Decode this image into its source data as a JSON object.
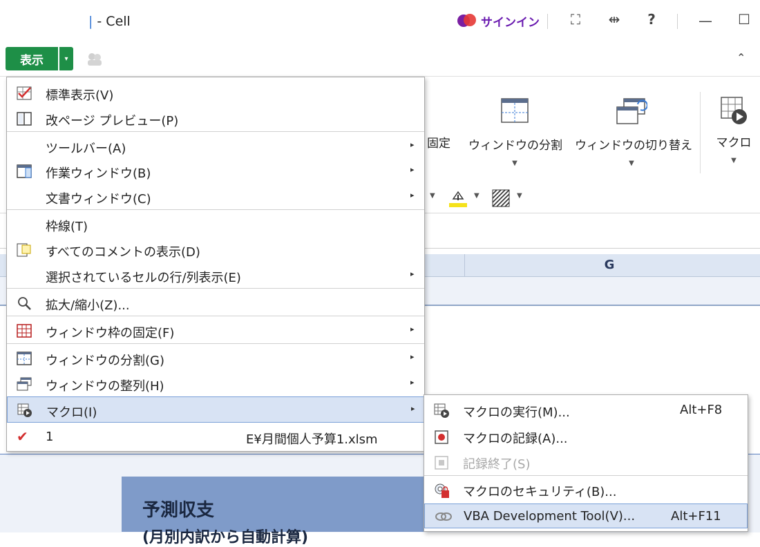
{
  "window": {
    "title": "- Cell",
    "signin": "サインイン",
    "buttons": {
      "fullscreen": "⛶",
      "split": "⇹",
      "help": "?",
      "minimize": "—",
      "maximize": "☐"
    }
  },
  "toolbar": {
    "view_label": "表示",
    "dropdown_glyph": "▾",
    "collapse_glyph": "⌃"
  },
  "ribbon": {
    "freeze_label": "固定",
    "split_window_label": "ウィンドウの分割",
    "switch_window_label": "ウィンドウの切り替え",
    "macro_label": "マクロ"
  },
  "sheet": {
    "column_g": "G",
    "forecast_title": "予測収支",
    "forecast_subtitle": "(月別内訳から自動計算)"
  },
  "menu": {
    "items": [
      {
        "label": "標準表示(V)",
        "icon": "checked-view-icon"
      },
      {
        "label": "改ページ プレビュー(P)",
        "icon": "page-break-icon"
      },
      {
        "label": "ツールバー(A)",
        "submenu": true
      },
      {
        "label": "作業ウィンドウ(B)",
        "icon": "task-pane-icon",
        "submenu": true
      },
      {
        "label": "文書ウィンドウ(C)",
        "submenu": true
      },
      {
        "label": "枠線(T)"
      },
      {
        "label": "すべてのコメントの表示(D)",
        "icon": "comment-icon"
      },
      {
        "label": "選択されているセルの行/列表示(E)",
        "submenu": true
      },
      {
        "label": "拡大/縮小(Z)...",
        "icon": "zoom-icon"
      },
      {
        "label": "ウィンドウ枠の固定(F)",
        "icon": "freeze-pane-icon",
        "submenu": true
      },
      {
        "label": "ウィンドウの分割(G)",
        "icon": "split-window-icon",
        "submenu": true
      },
      {
        "label": "ウィンドウの整列(H)",
        "icon": "arrange-window-icon",
        "submenu": true
      },
      {
        "label": "マクロ(I)",
        "icon": "macro-icon",
        "submenu": true,
        "highlighted": true
      },
      {
        "label": "1",
        "right_text": "E¥月間個人予算1.xlsm",
        "icon": "checkmark-icon"
      }
    ],
    "arrow": "▸"
  },
  "submenu": {
    "items": [
      {
        "label": "マクロの実行(M)...",
        "shortcut": "Alt+F8",
        "icon": "run-macro-icon"
      },
      {
        "label": "マクロの記録(A)...",
        "icon": "record-macro-icon"
      },
      {
        "label": "記録終了(S)",
        "icon": "stop-record-icon",
        "disabled": true
      },
      {
        "label": "マクロのセキュリティ(B)...",
        "icon": "macro-security-icon"
      },
      {
        "label": "VBA Development Tool(V)...",
        "shortcut": "Alt+F11",
        "icon": "vba-tool-icon",
        "highlighted": true
      }
    ]
  },
  "colors": {
    "accent_green": "#1e8f47",
    "highlight": "#d8e3f4",
    "signin_purple": "#6a1bb0"
  }
}
